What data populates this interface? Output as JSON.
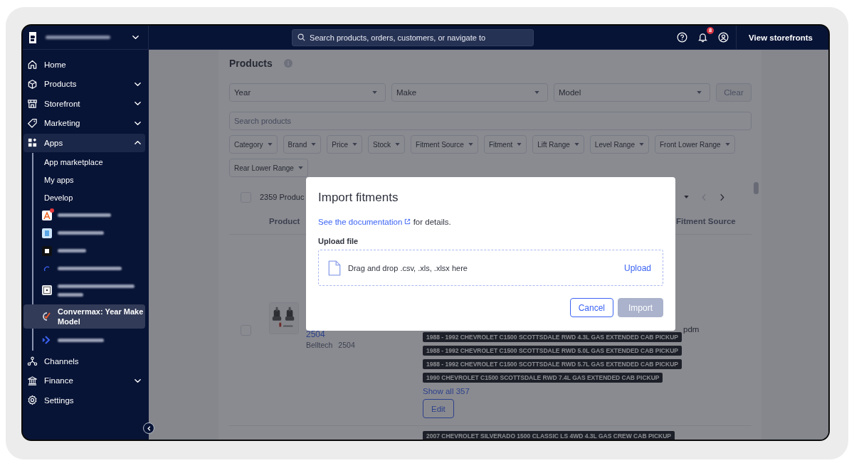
{
  "topbar": {
    "search_placeholder": "Search products, orders, customers, or navigate to",
    "notification_count": "8",
    "storefront_button": "View storefronts"
  },
  "sidebar": {
    "items": [
      {
        "label": "Home",
        "selected": false
      },
      {
        "label": "Products",
        "selected": false,
        "expanded": false
      },
      {
        "label": "Storefront",
        "selected": false,
        "expanded": false
      },
      {
        "label": "Marketing",
        "selected": false,
        "expanded": false
      },
      {
        "label": "Apps",
        "selected": true,
        "expanded": true,
        "children": [
          {
            "kind": "link",
            "label": "App marketplace",
            "selected": false
          },
          {
            "kind": "link",
            "label": "My apps",
            "selected": false
          },
          {
            "kind": "link",
            "label": "Develop",
            "selected": false
          },
          {
            "kind": "redacted",
            "selected": false,
            "notification": true
          },
          {
            "kind": "redacted",
            "selected": false,
            "notification": false
          },
          {
            "kind": "redacted",
            "selected": false,
            "notification": false
          },
          {
            "kind": "redacted",
            "selected": false,
            "notification": false
          },
          {
            "kind": "redacted-tall",
            "selected": false,
            "notification": false
          },
          {
            "kind": "app",
            "label": "Convermax: Year Make Model",
            "selected": true,
            "notification": false
          },
          {
            "kind": "redacted",
            "selected": false,
            "notification": false
          }
        ]
      },
      {
        "label": "Channels",
        "selected": false
      },
      {
        "label": "Finance",
        "selected": false,
        "expanded": false
      },
      {
        "label": "Settings",
        "selected": false
      }
    ]
  },
  "page": {
    "title": "Products",
    "vehicle_selects": [
      {
        "label": "Year"
      },
      {
        "label": "Make"
      },
      {
        "label": "Model"
      }
    ],
    "clear_button": {
      "label": "Clear",
      "disabled": true
    },
    "search": {
      "placeholder": "Search products"
    },
    "filters": [
      "Category",
      "Brand",
      "Price",
      "Stock",
      "Fitment Source",
      "Fitment",
      "Lift Range",
      "Level Range",
      "Front Lower Range",
      "Rear Lower Range"
    ],
    "table": {
      "all_checked": false,
      "count": "2359 Produc",
      "columns": [
        "Product",
        "Fitment Source"
      ],
      "rows": [
        {
          "checked": false,
          "name": "2504",
          "brand": "Belltech",
          "sku": "2504",
          "fitments": [
            "1988 - 1992 CHEVROLET C1500 SCOTTSDALE RWD 4.3L GAS EXTENDED CAB PICKUP",
            "1988 - 1992 CHEVROLET C1500 SCOTTSDALE RWD 5.0L GAS EXTENDED CAB PICKUP",
            "1988 - 1992 CHEVROLET C1500 SCOTTSDALE RWD 5.7L GAS EXTENDED CAB PICKUP",
            "1990 CHEVROLET C1500 SCOTTSDALE RWD 7.4L GAS EXTENDED CAB PICKUP"
          ],
          "show_all": "Show all 357",
          "edit": "Edit",
          "fitment_source": "pdm"
        },
        {
          "fitments": [
            "2007 CHEVROLET SILVERADO 1500 CLASSIC LS 4WD 4.3L GAS CREW CAB PICKUP"
          ]
        }
      ]
    }
  },
  "modal": {
    "title": "Import fitments",
    "link": "See the documentation",
    "link_suffix": " for details.",
    "upload_label": "Upload file",
    "drop_text": "Drag and drop .csv, .xls, .xlsx here",
    "upload_button": "Upload",
    "buttons": [
      {
        "label": "Cancel",
        "disabled": false,
        "kind": "secondary"
      },
      {
        "label": "Import",
        "disabled": true,
        "kind": "primary"
      }
    ]
  }
}
